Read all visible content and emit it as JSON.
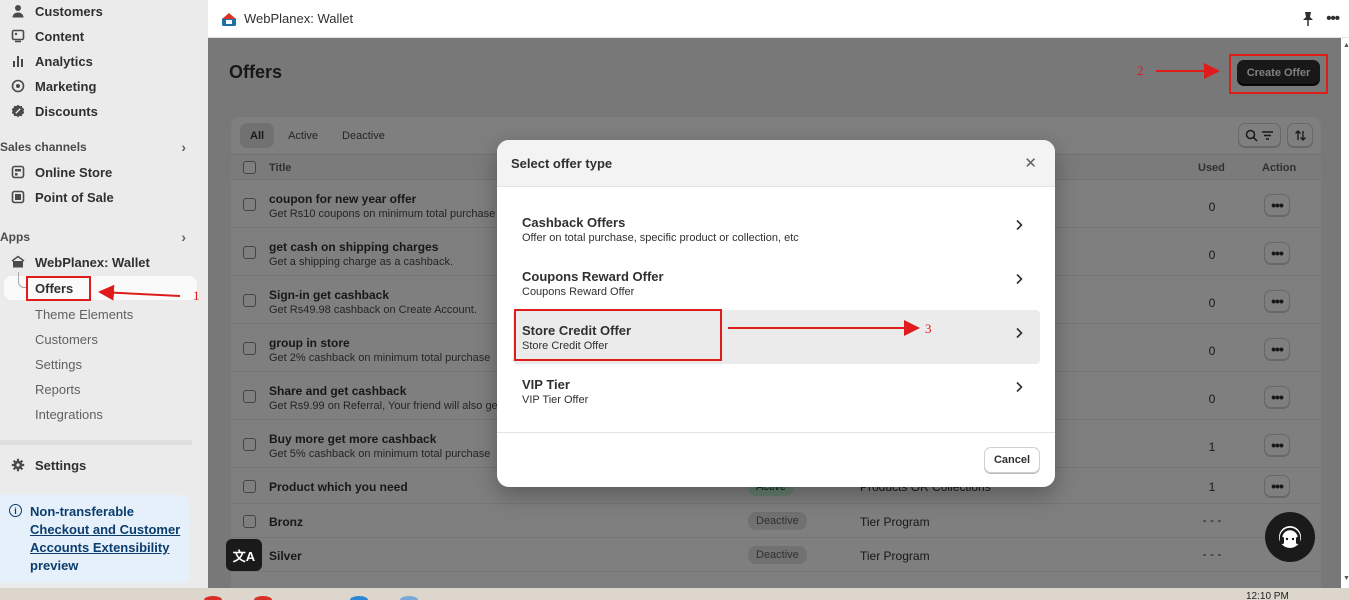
{
  "sidebar": {
    "top_items": [
      {
        "label": "Customers",
        "icon": "person-icon"
      },
      {
        "label": "Content",
        "icon": "content-icon"
      },
      {
        "label": "Analytics",
        "icon": "bar-chart-icon"
      },
      {
        "label": "Marketing",
        "icon": "target-icon"
      },
      {
        "label": "Discounts",
        "icon": "discount-icon"
      }
    ],
    "sales_channels": {
      "heading": "Sales channels",
      "items": [
        {
          "label": "Online Store",
          "icon": "store-icon"
        },
        {
          "label": "Point of Sale",
          "icon": "pos-icon"
        }
      ]
    },
    "apps": {
      "heading": "Apps",
      "app_name": "WebPlanex: Wallet",
      "sub_items": [
        "Offers",
        "Theme Elements",
        "Customers",
        "Settings",
        "Reports",
        "Integrations"
      ],
      "selected": "Offers"
    },
    "settings_label": "Settings",
    "notice": {
      "title": "Non-transferable",
      "link": "Checkout and Customer Accounts Extensibility",
      "suffix": "preview"
    }
  },
  "topbar": {
    "app_title": "WebPlanex: Wallet"
  },
  "page": {
    "title": "Offers",
    "create_button": "Create Offer",
    "tabs": [
      "All",
      "Active",
      "Deactive"
    ],
    "selected_tab": "All",
    "columns": {
      "title": "Title",
      "used": "Used",
      "action": "Action"
    },
    "rows": [
      {
        "title": "coupon for new year offer",
        "desc": "Get Rs10 coupons on minimum total purchase",
        "used": "0"
      },
      {
        "title": "get cash on shipping charges",
        "desc": "Get a shipping charge as a cashback.",
        "used": "0"
      },
      {
        "title": "Sign-in get cashback",
        "desc": "Get Rs49.98 cashback on Create Account.",
        "used": "0"
      },
      {
        "title": "group in store",
        "desc": "Get 2% cashback on minimum total purchase",
        "used": "0"
      },
      {
        "title": "Share and get cashback",
        "desc": "Get Rs9.99 on Referral, Your friend will also get",
        "used": "0"
      },
      {
        "title": "Buy more get more cashback",
        "desc": "Get 5% cashback on minimum total purchase",
        "used": "1"
      },
      {
        "title": "Product which you need",
        "desc": "",
        "status": "Active",
        "type": "Products OR Collections",
        "used": "1"
      },
      {
        "title": "Bronz",
        "desc": "",
        "status": "Deactive",
        "type": "Tier Program",
        "used": "- - -"
      },
      {
        "title": "Silver",
        "desc": "",
        "status": "Deactive",
        "type": "Tier Program",
        "used": "- - -"
      }
    ]
  },
  "modal": {
    "title": "Select offer type",
    "options": [
      {
        "title": "Cashback Offers",
        "desc": "Offer on total purchase, specific product or collection, etc"
      },
      {
        "title": "Coupons Reward Offer",
        "desc": "Coupons Reward Offer"
      },
      {
        "title": "Store Credit Offer",
        "desc": "Store Credit Offer"
      },
      {
        "title": "VIP Tier",
        "desc": "VIP Tier Offer"
      }
    ],
    "highlighted_option": "Store Credit Offer",
    "cancel_label": "Cancel"
  },
  "annotations": {
    "numbers": [
      "1",
      "2",
      "3"
    ],
    "color": "#e01b1b"
  },
  "misc": {
    "translate_glyph": "文A",
    "taskbar_time": "12:10 PM"
  }
}
